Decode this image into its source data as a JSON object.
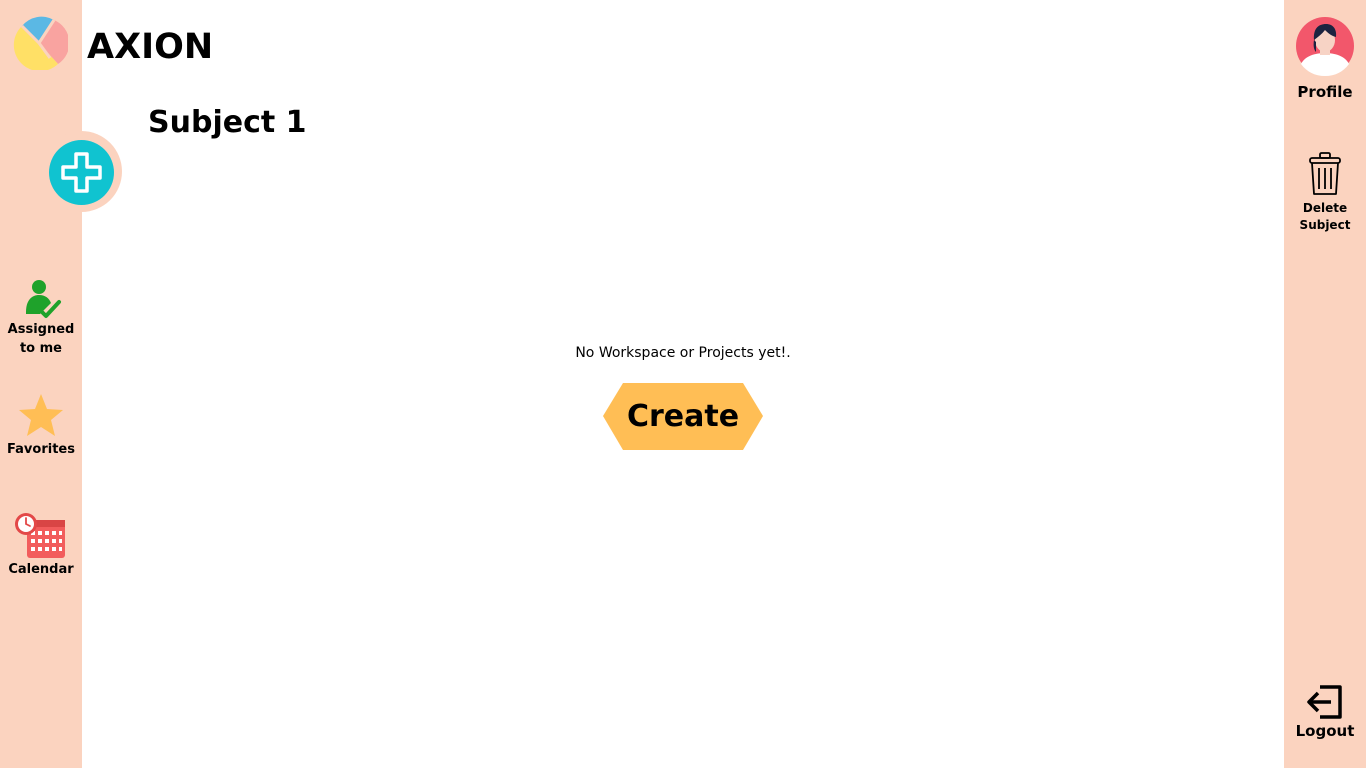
{
  "brand": {
    "name": "AXION",
    "logo_icon": "pie-logo-icon"
  },
  "page": {
    "title": "Subject 1"
  },
  "actions": {
    "add_icon": "plus-icon"
  },
  "left_nav": {
    "items": [
      {
        "label_line1": "Assigned",
        "label_line2": "to me",
        "icon": "user-check-icon"
      },
      {
        "label": "Favorites",
        "icon": "star-icon"
      },
      {
        "label": "Calendar",
        "icon": "calendar-icon"
      }
    ]
  },
  "right_nav": {
    "profile_label": "Profile",
    "delete_label_line1": "Delete",
    "delete_label_line2": "Subject",
    "logout_label": "Logout"
  },
  "main": {
    "empty_message": "No Workspace or Projects yet!.",
    "create_label": "Create"
  },
  "colors": {
    "rail": "#fbd3bf",
    "accent_teal": "#10c3d0",
    "create_yellow": "#ffbe55",
    "star": "#ffbe55",
    "calendar_red": "#f25c5c",
    "assigned_green": "#1fa22b"
  }
}
